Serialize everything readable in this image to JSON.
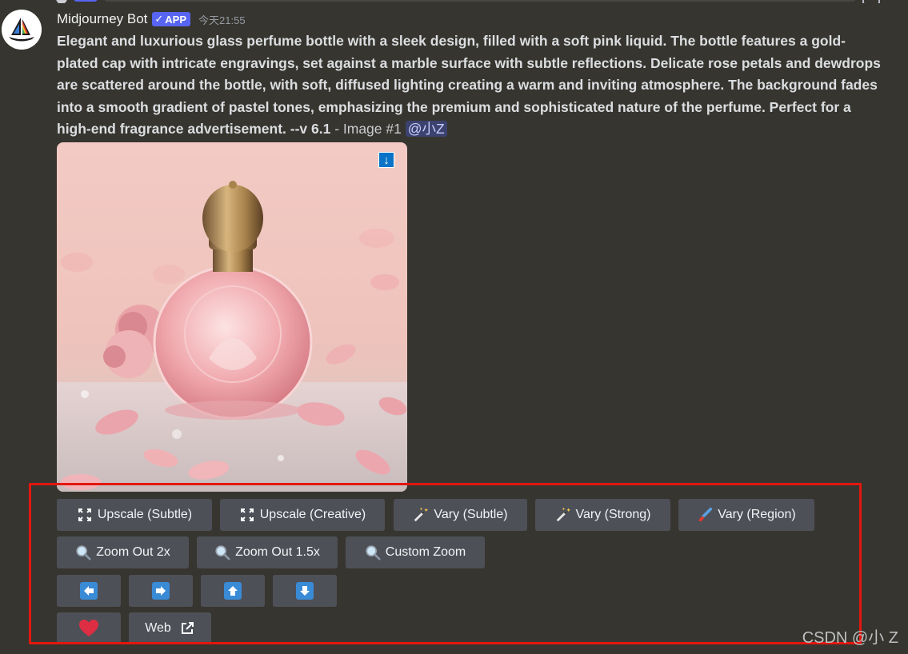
{
  "author": {
    "name": "Midjourney Bot",
    "badge": "APP",
    "badge_check": "✓",
    "timestamp": "今天21:55"
  },
  "message": {
    "prompt": "Elegant and luxurious glass perfume bottle with a sleek design, filled with a soft pink liquid. The bottle features a gold-plated cap with intricate engravings, set against a marble surface with subtle reflections. Delicate rose petals and dewdrops are scattered around the bottle, with soft, diffused lighting creating a warm and inviting atmosphere. The background fades into a smooth gradient of pastel tones, emphasizing the premium and sophisticated nature of the perfume. Perfect for a high-end fragrance advertisement. --v 6.1",
    "suffix": " - Image #1 ",
    "mention": "@小Z"
  },
  "image": {
    "download_icon": "download-arrow-icon"
  },
  "buttons": {
    "row1": [
      {
        "label": "Upscale (Subtle)",
        "icon": "expand-icon"
      },
      {
        "label": "Upscale (Creative)",
        "icon": "expand-icon"
      },
      {
        "label": "Vary (Subtle)",
        "icon": "magic-wand-icon"
      },
      {
        "label": "Vary (Strong)",
        "icon": "magic-wand-icon"
      },
      {
        "label": "Vary (Region)",
        "icon": "paintbrush-icon"
      }
    ],
    "row2": [
      {
        "label": "Zoom Out 2x",
        "icon": "magnifier-icon"
      },
      {
        "label": "Zoom Out 1.5x",
        "icon": "magnifier-icon"
      },
      {
        "label": "Custom Zoom",
        "icon": "magnifier-icon"
      }
    ],
    "row3": [
      {
        "icon": "arrow-left-icon"
      },
      {
        "icon": "arrow-right-icon"
      },
      {
        "icon": "arrow-up-icon"
      },
      {
        "icon": "arrow-down-icon"
      }
    ],
    "row4": [
      {
        "icon": "heart-icon"
      },
      {
        "label": "Web",
        "icon": "external-link-icon"
      }
    ]
  },
  "watermark": "CSDN @小 Z",
  "colors": {
    "background": "#37352f",
    "button": "#4e5058",
    "badge": "#5865f2",
    "highlight_border": "#e2170f"
  }
}
